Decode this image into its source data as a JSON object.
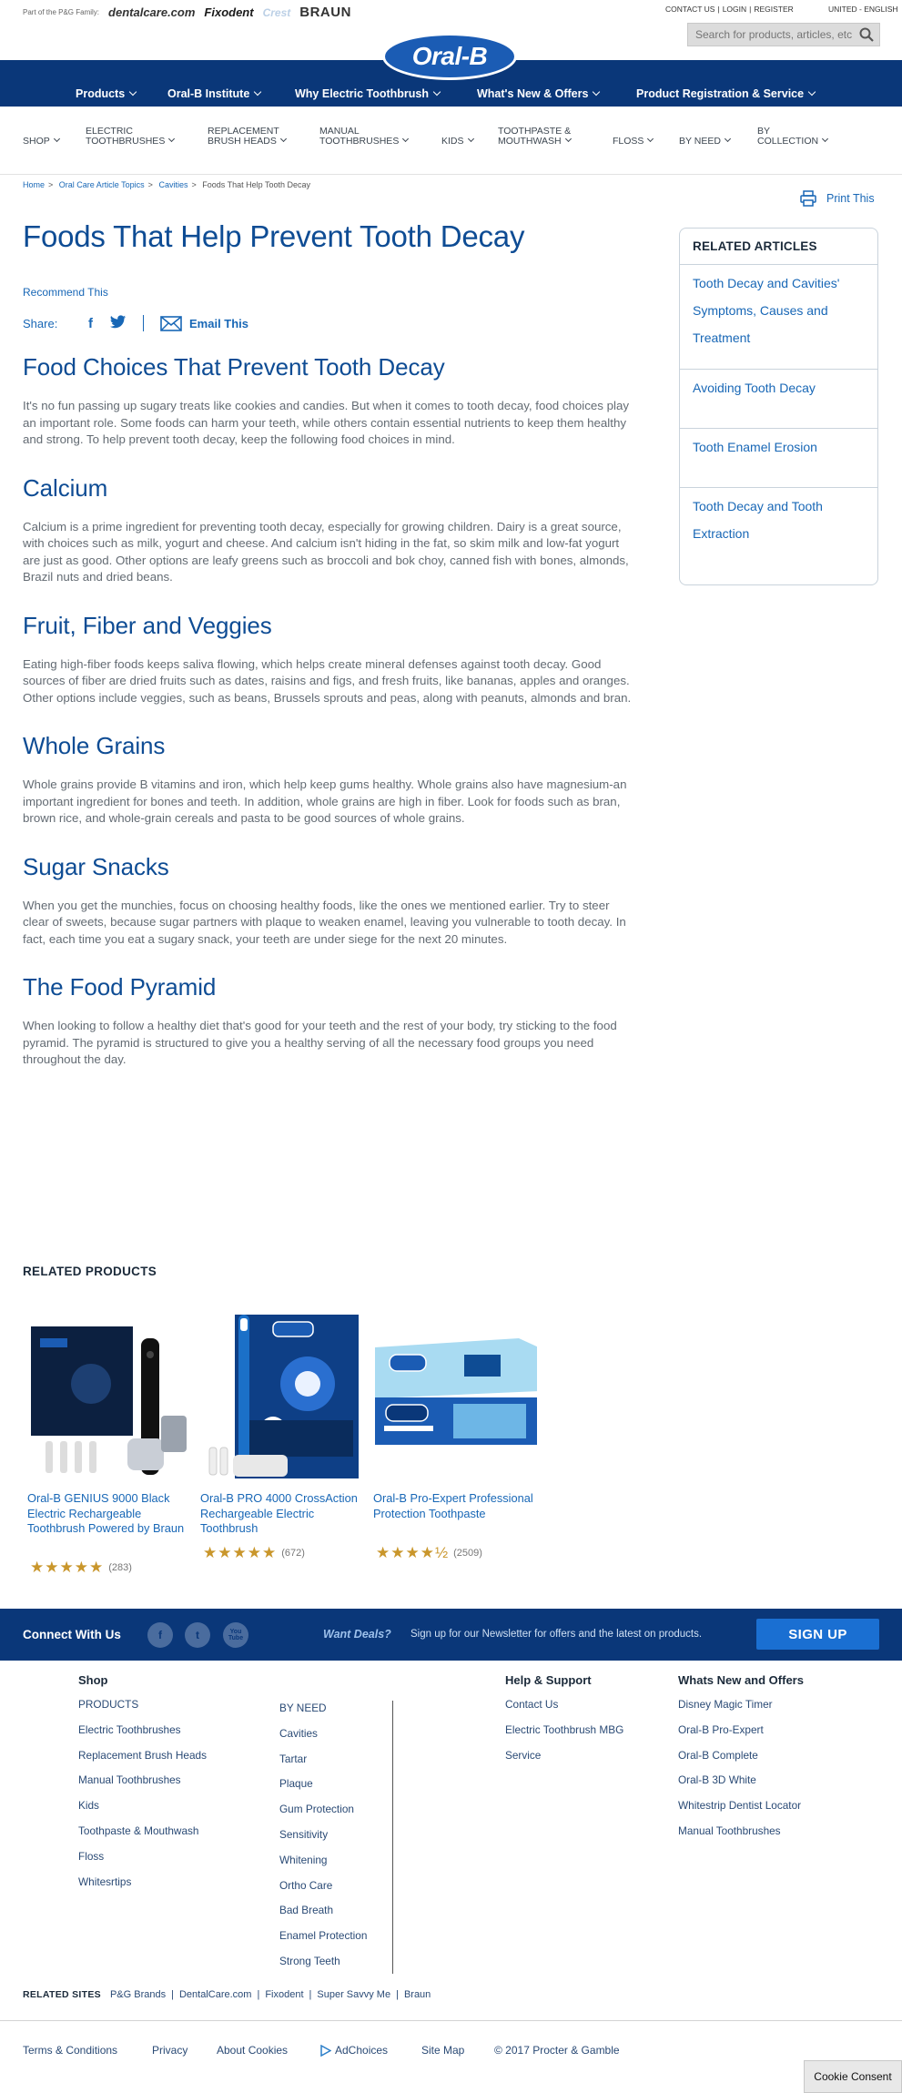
{
  "topbar": {
    "family_label": "Part of the P&G Family:",
    "brands": [
      "dentalcare.com",
      "Fixodent",
      "Crest",
      "BRAUN"
    ],
    "contact": "CONTACT US",
    "login": "LOGIN",
    "register": "REGISTER",
    "country": "UNITED - ENGLISH",
    "search_placeholder": "Search for products, articles, etc."
  },
  "logo": "Oral-B",
  "main_nav": [
    {
      "label": "Products"
    },
    {
      "label": "Oral-B Institute"
    },
    {
      "label": "Why Electric Toothbrush"
    },
    {
      "label": "What's New & Offers"
    },
    {
      "label": "Product Registration & Service"
    }
  ],
  "category_nav": [
    {
      "line1": "SHOP",
      "line2": ""
    },
    {
      "line1": "ELECTRIC",
      "line2": "TOOTHBRUSHES"
    },
    {
      "line1": "REPLACEMENT",
      "line2": "BRUSH HEADS"
    },
    {
      "line1": "MANUAL",
      "line2": "TOOTHBRUSHES"
    },
    {
      "line1": "KIDS",
      "line2": ""
    },
    {
      "line1": "TOOTHPASTE &",
      "line2": "MOUTHWASH"
    },
    {
      "line1": "FLOSS",
      "line2": ""
    },
    {
      "line1": "BY NEED",
      "line2": ""
    },
    {
      "line1": "BY",
      "line2": "COLLECTION"
    }
  ],
  "breadcrumb": {
    "items": [
      "Home",
      "Oral Care Article Topics",
      "Cavities"
    ],
    "current": "Foods That Help Tooth Decay"
  },
  "print_label": "Print This",
  "article": {
    "title": "Foods That Help Prevent Tooth Decay",
    "recommend": "Recommend This",
    "share_label": "Share:",
    "email_label": "Email This",
    "sections": [
      {
        "heading": "Food Choices That Prevent Tooth Decay",
        "body": "It's no fun passing up sugary treats like cookies and candies. But when it comes to tooth decay, food choices play an important role. Some foods can harm your teeth, while others contain essential nutrients to keep them healthy and strong. To help prevent tooth decay, keep the following food choices in mind."
      },
      {
        "heading": "Calcium",
        "body": "Calcium is a prime ingredient for preventing tooth decay, especially for growing children. Dairy is a great source, with choices such as milk, yogurt and cheese. And calcium isn't hiding in the fat, so skim milk and low-fat yogurt are just as good. Other options are leafy greens such as broccoli and bok choy, canned fish with bones, almonds, Brazil nuts and dried beans."
      },
      {
        "heading": "Fruit, Fiber and Veggies",
        "body": "Eating high-fiber foods keeps saliva flowing, which helps create mineral defenses against tooth decay. Good sources of fiber are dried fruits such as dates, raisins and figs, and fresh fruits, like bananas, apples and oranges. Other options include veggies, such as beans, Brussels sprouts and peas, along with peanuts, almonds and bran."
      },
      {
        "heading": "Whole Grains",
        "body": "Whole grains provide B vitamins and iron, which help keep gums healthy. Whole grains also have magnesium-an important ingredient for bones and teeth. In addition, whole grains are high in fiber. Look for foods such as bran, brown rice, and whole-grain cereals and pasta to be good sources of whole grains."
      },
      {
        "heading": "Sugar Snacks",
        "body": "When you get the munchies, focus on choosing healthy foods, like the ones we mentioned earlier. Try to steer clear of sweets, because sugar partners with plaque to weaken enamel, leaving you vulnerable to tooth decay. In fact, each time you eat a sugary snack, your teeth are under siege for the next 20 minutes."
      },
      {
        "heading": "The Food Pyramid",
        "body": "When looking to follow a healthy diet that's good for your teeth and the rest of your body, try sticking to the food pyramid. The pyramid is structured to give you a healthy serving of all the necessary food groups you need throughout the day."
      }
    ]
  },
  "related_articles": {
    "heading": "RELATED ARTICLES",
    "items": [
      "Tooth Decay and Cavities' Symptoms, Causes and Treatment",
      "Avoiding Tooth Decay",
      "Tooth Enamel Erosion",
      "Tooth Decay and Tooth Extraction"
    ]
  },
  "related_products": {
    "heading": "RELATED PRODUCTS",
    "items": [
      {
        "name": "Oral-B GENIUS 9000 Black Electric Rechargeable Toothbrush Powered by Braun",
        "rating": 5,
        "reviews": "(283)",
        "stars": "★★★★★"
      },
      {
        "name": "Oral-B PRO 4000 CrossAction Rechargeable Electric Toothbrush",
        "rating": 5,
        "reviews": "(672)",
        "stars": "★★★★★"
      },
      {
        "name": "Oral-B Pro-Expert Professional Protection Toothpaste",
        "rating": 4.5,
        "reviews": "(2509)",
        "stars": "★★★★½"
      }
    ]
  },
  "connect": {
    "label": "Connect With Us",
    "social": [
      "f",
      "t",
      "You Tube"
    ],
    "deals": "Want Deals?",
    "newsletter": "Sign up for our Newsletter for offers and the latest on products.",
    "signup": "SIGN UP"
  },
  "footer": {
    "shop_heading": "Shop",
    "products": [
      "PRODUCTS",
      "Electric Toothbrushes",
      "Replacement Brush Heads",
      "Manual Toothbrushes",
      "Kids",
      "Toothpaste & Mouthwash",
      "Floss",
      "Whitesrtips"
    ],
    "by_need": [
      "BY NEED",
      "Cavities",
      "Tartar",
      "Plaque",
      "Gum Protection",
      "Sensitivity",
      "Whitening",
      "Ortho Care",
      "Bad Breath",
      "Enamel Protection",
      "Strong Teeth"
    ],
    "help_heading": "Help & Support",
    "help": [
      "Contact Us",
      "Electric Toothbrush MBG",
      "Service"
    ],
    "whats_new_heading": "Whats New and Offers",
    "whats_new": [
      "Disney Magic Timer",
      "Oral-B Pro-Expert",
      "Oral-B Complete",
      "Oral-B 3D White",
      "Whitestrip Dentist Locator",
      "Manual Toothbrushes"
    ],
    "related_sites_label": "RELATED SITES",
    "related_sites": [
      "P&G Brands",
      "DentalCare.com",
      "Fixodent",
      "Super Savvy Me",
      "Braun"
    ],
    "legal": [
      "Terms & Conditions",
      "Privacy",
      "About Cookies",
      "AdChoices",
      "Site Map",
      "© 2017 Procter & Gamble"
    ]
  },
  "cookie_consent": "Cookie Consent",
  "colors": {
    "brand_blue": "#0a3779",
    "link_blue": "#1867b6",
    "heading_blue": "#0e4c94",
    "star_gold": "#c9962b",
    "signup_blue": "#1a6fd2"
  }
}
